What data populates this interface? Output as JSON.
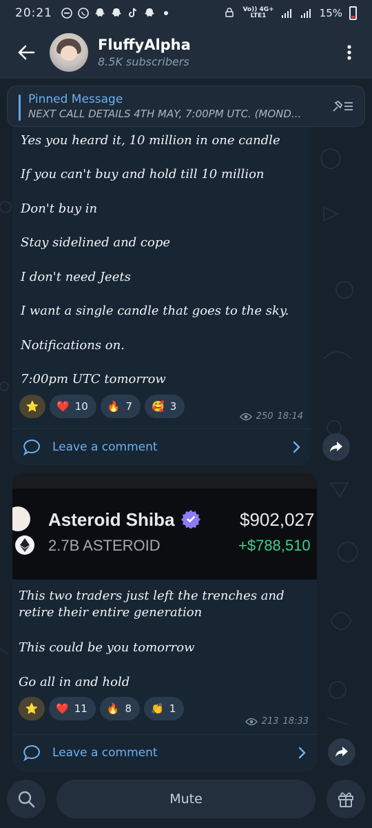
{
  "status_bar": {
    "time": "20:21",
    "network_top": "Vo)) 4G+",
    "network_bottom": "LTE1",
    "battery": "15%"
  },
  "header": {
    "channel_name": "FluffyAlpha",
    "subscribers": "8.5K subscribers"
  },
  "pinned": {
    "title": "Pinned Message",
    "text": "NEXT CALL DETAILS 4TH MAY, 7:00PM UTC. (MOND..."
  },
  "messages": [
    {
      "paragraphs": [
        "Yes you heard it, 10 million in one candle",
        "If you can't buy and hold till 10 million",
        "Don't buy in",
        "Stay sidelined and cope",
        "I don't need Jeets",
        "I want a single candle that goes to the sky.",
        "Notifications on.",
        "7:00pm UTC tomorrow"
      ],
      "reactions": [
        {
          "emoji": "⭐",
          "count": ""
        },
        {
          "emoji": "❤️",
          "count": "10"
        },
        {
          "emoji": "🔥",
          "count": "7"
        },
        {
          "emoji": "🥰",
          "count": "3"
        }
      ],
      "views": "250",
      "time": "18:14",
      "comment_label": "Leave a comment"
    },
    {
      "image": {
        "token_name": "Asteroid Shiba",
        "token_amount": "2.7B ASTEROID",
        "usd_value": "$902,027",
        "gain": "+$788,510"
      },
      "paragraphs": [
        "This two traders just left the trenches and retire their entire generation",
        "This could be you tomorrow",
        "Go all in and hold"
      ],
      "reactions": [
        {
          "emoji": "⭐",
          "count": ""
        },
        {
          "emoji": "❤️",
          "count": "11"
        },
        {
          "emoji": "🔥",
          "count": "8"
        },
        {
          "emoji": "👏",
          "count": "1"
        }
      ],
      "views": "213",
      "time": "18:33",
      "comment_label": "Leave a comment"
    }
  ],
  "bottom_bar": {
    "mute_label": "Mute"
  },
  "colors": {
    "accent": "#6ab2f2",
    "bubble": "#182533",
    "header": "#212d3b",
    "gain_green": "#3fcf8e"
  }
}
